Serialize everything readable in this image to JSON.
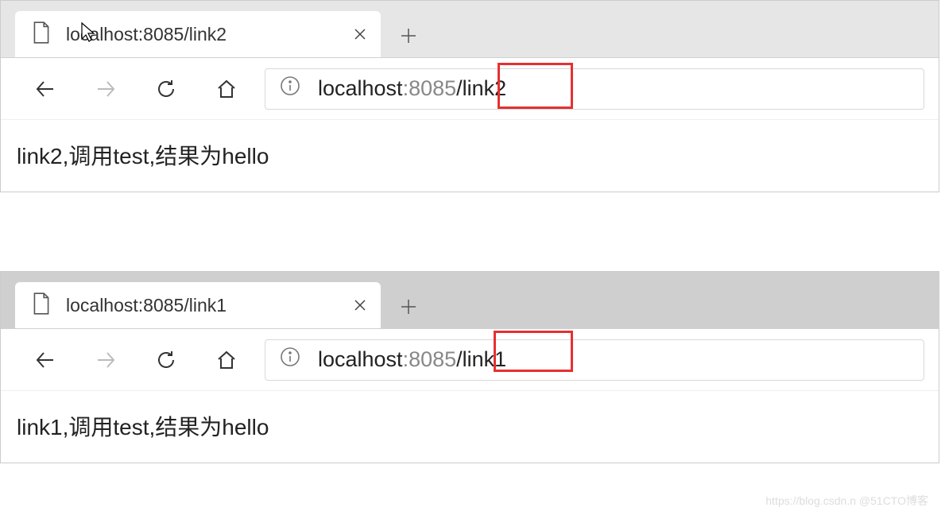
{
  "window1": {
    "tab_title": "localhost:8085/link2",
    "url_host": "localhost",
    "url_port": ":8085",
    "url_path": "/link2",
    "page_text": "link2,调用test,结果为hello"
  },
  "window2": {
    "tab_title": "localhost:8085/link1",
    "url_host": "localhost",
    "url_port": ":8085",
    "url_path": "/link1",
    "page_text": "link1,调用test,结果为hello"
  },
  "watermark": "https://blog.csdn.n @51CTO博客"
}
